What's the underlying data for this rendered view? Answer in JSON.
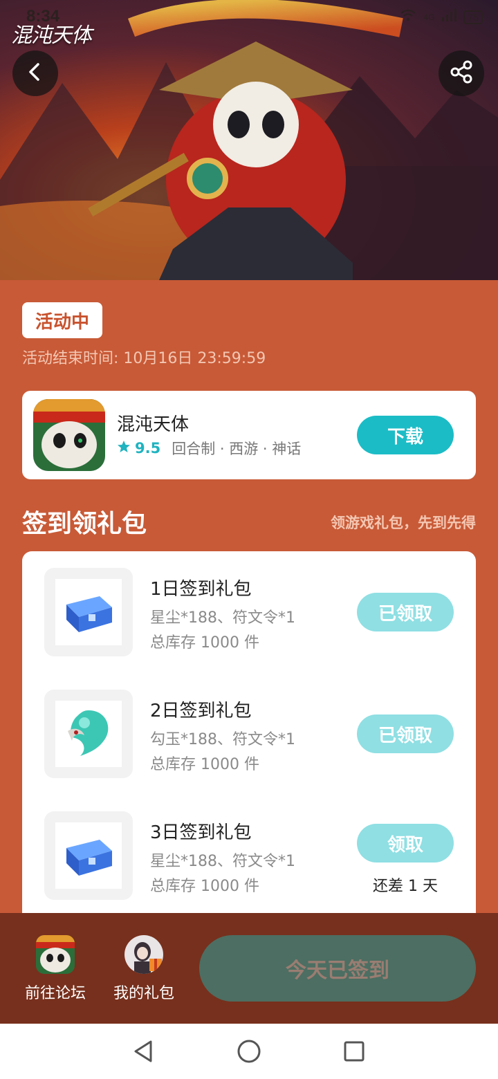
{
  "status_bar": {
    "time": "8:34",
    "network": "4G",
    "battery": "75"
  },
  "banner": {
    "logo_text": "混沌天体"
  },
  "activity": {
    "status": "活动中",
    "end_time": "活动结束时间: 10月16日 23:59:59"
  },
  "app": {
    "name": "混沌天体",
    "rating": "9.5",
    "tags": "回合制 · 西游 · 神话",
    "download_label": "下载"
  },
  "section": {
    "title": "签到领礼包",
    "subtitle": "领游戏礼包，先到先得"
  },
  "gifts": [
    {
      "name": "1日签到礼包",
      "desc": "星尘*188、符文令*1",
      "stock": "总库存 1000 件",
      "button": "已领取",
      "icon": "blue-chest-icon"
    },
    {
      "name": "2日签到礼包",
      "desc": "勾玉*188、符文令*1",
      "stock": "总库存 1000 件",
      "button": "已领取",
      "icon": "jade-magatama-icon"
    },
    {
      "name": "3日签到礼包",
      "desc": "星尘*188、符文令*1",
      "stock": "总库存 1000 件",
      "button": "领取",
      "note": "还差 1 天",
      "icon": "blue-chest-icon"
    }
  ],
  "bottom_bar": {
    "forum_label": "前往论坛",
    "mygifts_label": "我的礼包",
    "signed_label": "今天已签到"
  },
  "colors": {
    "page_bg": "#c85a37",
    "accent": "#1bbcc6",
    "disabled_btn": "#8fdfe3",
    "bottom_bg": "#77301d"
  }
}
